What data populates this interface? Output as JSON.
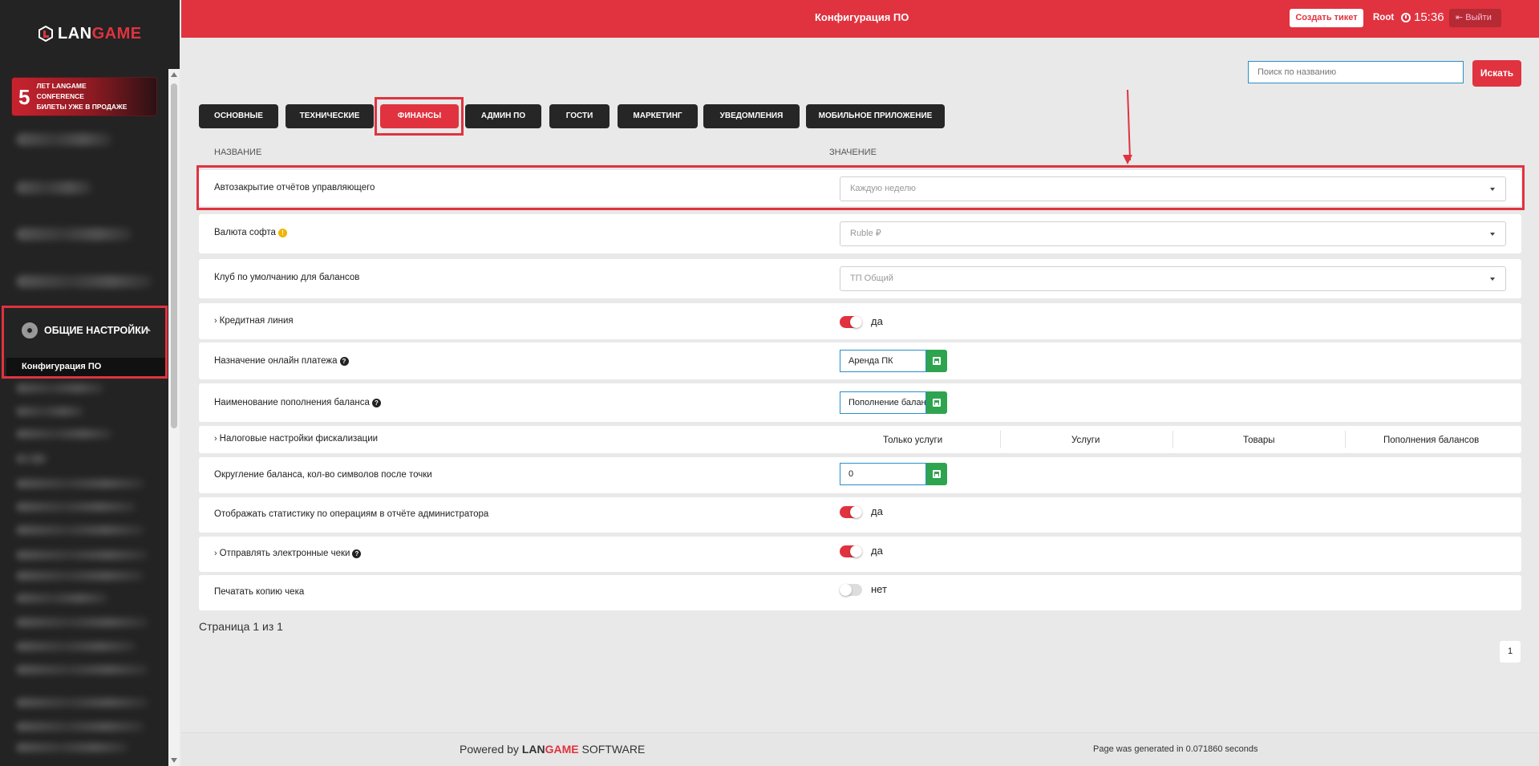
{
  "sidebar": {
    "logo": {
      "text_pre": "LAN",
      "text_post": "GAME"
    },
    "promo": {
      "number": "5",
      "line1": "ЛЕТ LANGAME",
      "line2": "CONFERENCE",
      "line3": "БИЛЕТЫ УЖЕ В ПРОДАЖЕ"
    },
    "active_group": "ОБЩИЕ НАСТРОЙКИ",
    "active_sub": "Конфигурация ПО"
  },
  "header": {
    "title": "Конфигурация ПО",
    "ticket_button": "Создать тикет",
    "user": "Root",
    "time": "15:36",
    "logout": "Выйти"
  },
  "search": {
    "placeholder": "Поиск по названию",
    "button": "Искать"
  },
  "tabs": [
    {
      "label": "Основные"
    },
    {
      "label": "Технические"
    },
    {
      "label": "Финансы",
      "active": true
    },
    {
      "label": "Админ ПО"
    },
    {
      "label": "Гости"
    },
    {
      "label": "Маркетинг"
    },
    {
      "label": "Уведомления"
    },
    {
      "label": "Мобильное приложение"
    }
  ],
  "table": {
    "col_name": "Название",
    "col_value": "Значение",
    "rows": [
      {
        "label": "Автозакрытие отчётов управляющего",
        "type": "select",
        "value": "Каждую неделю"
      },
      {
        "label": "Валюта софта",
        "type": "select",
        "value": "Ruble ₽",
        "icon": "warning-icon"
      },
      {
        "label": "Клуб по умолчанию для балансов",
        "type": "select",
        "value": "ТП Общий"
      },
      {
        "label": "Кредитная линия",
        "type": "toggle",
        "on": true,
        "value": "да",
        "expandable": true
      },
      {
        "label": "Назначение онлайн платежа",
        "type": "input",
        "value": "Аренда ПК",
        "icon": "question-icon"
      },
      {
        "label": "Наименование пополнения баланса",
        "type": "input",
        "value": "Пополнение баланса",
        "icon": "question-icon"
      },
      {
        "label": "Налоговые настройки фискализации",
        "type": "tax",
        "expandable": true,
        "columns": [
          "Только услуги",
          "Услуги",
          "Товары",
          "Пополнения балансов"
        ]
      },
      {
        "label": "Округление баланса, кол-во символов после точки",
        "type": "input",
        "value": "0"
      },
      {
        "label": "Отображать статистику по операциям в отчёте администратора",
        "type": "toggle",
        "on": true,
        "value": "да"
      },
      {
        "label": "Отправлять электронные чеки",
        "type": "toggle",
        "on": true,
        "value": "да",
        "expandable": true,
        "icon": "question-icon"
      },
      {
        "label": "Печатать копию чека",
        "type": "toggle",
        "on": false,
        "value": "нет"
      }
    ]
  },
  "pager": {
    "text": "Страница 1 из 1",
    "current": "1"
  },
  "footer": {
    "powered_pre": "Powered by",
    "brand_pre": "LAN",
    "brand_post": "GAME",
    "powered_post": "SOFTWARE",
    "generated": "Page was generated in 0.071860 seconds"
  },
  "colors": {
    "accent": "#e0333f",
    "sidebar": "#232323",
    "success": "#2ea44f"
  }
}
